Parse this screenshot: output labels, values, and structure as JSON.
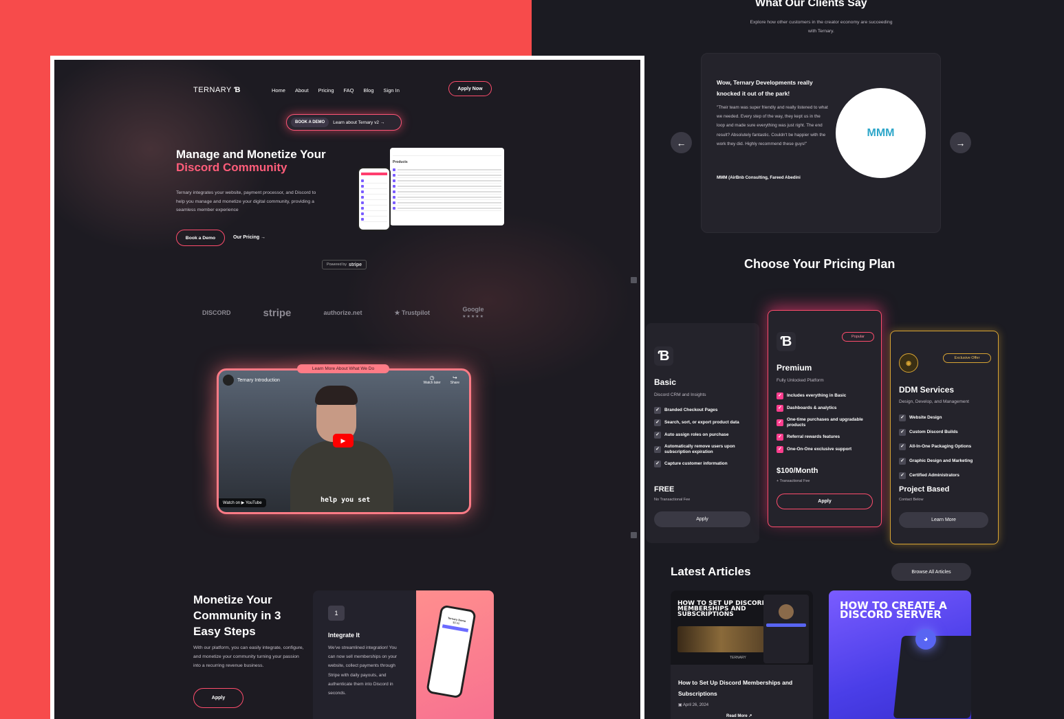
{
  "landing": {
    "logo": "TERNARY",
    "nav": [
      "Home",
      "About",
      "Pricing",
      "FAQ",
      "Blog",
      "Sign In"
    ],
    "apply_now": "Apply Now",
    "pill_demo": "BOOK A DEMO",
    "pill_learn": "Learn about Ternary v2 →",
    "hero_line1": "Manage and Monetize Your",
    "hero_line2": "Discord Community",
    "hero_desc": "Ternary integrates your website, payment processor, and Discord to help you manage and monetize your digital community, providing a seamless member experience",
    "book_demo": "Book a Demo",
    "our_pricing": "Our Pricing →",
    "powered_by": "Powered by",
    "powered_brand": "stripe",
    "mock_products_title": "Products",
    "logos": [
      "DISCORD",
      "stripe",
      "authorize.net",
      "★ Trustpilot",
      "Google"
    ],
    "google_stars": "★★★★★",
    "video_tag": "Learn More About What We Do",
    "video_title": "Ternary Introduction",
    "video_watch_later": "Watch later",
    "video_share": "Share",
    "video_caption": "help you set",
    "video_watch_on": "Watch on ▶ YouTube",
    "steps_title": "Monetize Your Community in 3 Easy Steps",
    "steps_desc": "With our platform, you can easily integrate, configure, and monetize your community turning your passion into a recurring revenue business.",
    "steps_apply": "Apply",
    "step_num": "1",
    "step_title": "Integrate It",
    "step_desc": "We've streamlined integration! You can now sell memberships on your website, collect payments through Stripe with daily payouts, and authenticate them into Discord in seconds.",
    "phone_product": "Ternary Demo",
    "phone_price": "$0.50"
  },
  "testimonials": {
    "title": "What Our Clients Say",
    "subtitle": "Explore how other customers in the creator economy are succeeding with Ternary.",
    "quote_title": "Wow, Ternary Developments really knocked it out of the park!",
    "quote": "\"Their team was super friendly and really listened to what we needed. Every step of the way, they kept us in the loop and made sure everything was just right. The end result? Absolutely fantastic. Couldn't be happier with the work they did. Highly recommend these guys!\"",
    "author": "MMM (AirBnb Consulting, Fareed Abedini",
    "logo_text": "MMM",
    "prev_icon": "←",
    "next_icon": "→"
  },
  "pricing": {
    "title": "Choose Your Pricing Plan",
    "basic": {
      "name": "Basic",
      "desc": "Discord CRM and Insights",
      "features": [
        "Branded Checkout Pages",
        "Search, sort, or export product data",
        "Auto assign roles on purchase",
        "Automatically remove users upon subscription expiration",
        "Capture customer information"
      ],
      "price": "FREE",
      "fee": "No Transactional Fee",
      "button": "Apply"
    },
    "premium": {
      "badge": "Popular",
      "name": "Premium",
      "desc": "Fully Unlocked Platform",
      "features": [
        "Includes everything in Basic",
        "Dashboards & analytics",
        "One-time purchases and upgradable products",
        "Referral rewards features",
        "One-On-One exclusive support"
      ],
      "price": "$100/Month",
      "fee": "+ Transactional Fee",
      "button": "Apply"
    },
    "ddm": {
      "badge": "Exclusive Offer",
      "name": "DDM Services",
      "desc": "Design, Develop, and Management",
      "features": [
        "Website Design",
        "Custom Discord Builds",
        "All-In-One Packaging Options",
        "Graphic Design and Marketing",
        "Certified Administrators"
      ],
      "price": "Project Based",
      "fee": "Contact Below",
      "button": "Learn More"
    }
  },
  "articles": {
    "title": "Latest Articles",
    "browse": "Browse All Articles",
    "items": [
      {
        "image_title": "HOW TO SET UP DISCORD MEMBERSHIPS AND SUBSCRIPTIONS",
        "title": "How to Set Up Discord Memberships and Subscriptions",
        "date": "April 26, 2024",
        "read_more": "Read More ↗",
        "brand": "TERNARY"
      },
      {
        "image_title": "HOW TO CREATE A DISCORD SERVER"
      }
    ]
  },
  "colors": {
    "accent_pink": "#ff4d6d",
    "gold": "#d9a534",
    "red_bg": "#f74b4b",
    "dark": "#1d1b22"
  }
}
